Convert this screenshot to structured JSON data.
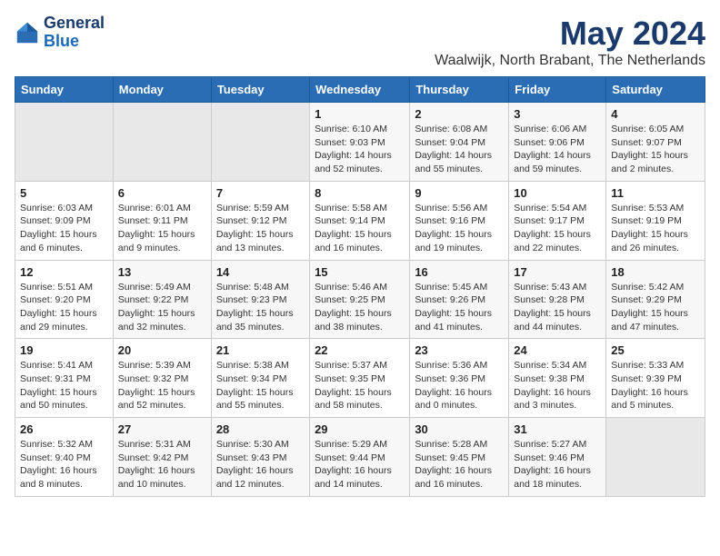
{
  "header": {
    "logo_line1": "General",
    "logo_line2": "Blue",
    "month": "May 2024",
    "location": "Waalwijk, North Brabant, The Netherlands"
  },
  "weekdays": [
    "Sunday",
    "Monday",
    "Tuesday",
    "Wednesday",
    "Thursday",
    "Friday",
    "Saturday"
  ],
  "weeks": [
    [
      {
        "day": "",
        "info": ""
      },
      {
        "day": "",
        "info": ""
      },
      {
        "day": "",
        "info": ""
      },
      {
        "day": "1",
        "info": "Sunrise: 6:10 AM\nSunset: 9:03 PM\nDaylight: 14 hours and 52 minutes."
      },
      {
        "day": "2",
        "info": "Sunrise: 6:08 AM\nSunset: 9:04 PM\nDaylight: 14 hours and 55 minutes."
      },
      {
        "day": "3",
        "info": "Sunrise: 6:06 AM\nSunset: 9:06 PM\nDaylight: 14 hours and 59 minutes."
      },
      {
        "day": "4",
        "info": "Sunrise: 6:05 AM\nSunset: 9:07 PM\nDaylight: 15 hours and 2 minutes."
      }
    ],
    [
      {
        "day": "5",
        "info": "Sunrise: 6:03 AM\nSunset: 9:09 PM\nDaylight: 15 hours and 6 minutes."
      },
      {
        "day": "6",
        "info": "Sunrise: 6:01 AM\nSunset: 9:11 PM\nDaylight: 15 hours and 9 minutes."
      },
      {
        "day": "7",
        "info": "Sunrise: 5:59 AM\nSunset: 9:12 PM\nDaylight: 15 hours and 13 minutes."
      },
      {
        "day": "8",
        "info": "Sunrise: 5:58 AM\nSunset: 9:14 PM\nDaylight: 15 hours and 16 minutes."
      },
      {
        "day": "9",
        "info": "Sunrise: 5:56 AM\nSunset: 9:16 PM\nDaylight: 15 hours and 19 minutes."
      },
      {
        "day": "10",
        "info": "Sunrise: 5:54 AM\nSunset: 9:17 PM\nDaylight: 15 hours and 22 minutes."
      },
      {
        "day": "11",
        "info": "Sunrise: 5:53 AM\nSunset: 9:19 PM\nDaylight: 15 hours and 26 minutes."
      }
    ],
    [
      {
        "day": "12",
        "info": "Sunrise: 5:51 AM\nSunset: 9:20 PM\nDaylight: 15 hours and 29 minutes."
      },
      {
        "day": "13",
        "info": "Sunrise: 5:49 AM\nSunset: 9:22 PM\nDaylight: 15 hours and 32 minutes."
      },
      {
        "day": "14",
        "info": "Sunrise: 5:48 AM\nSunset: 9:23 PM\nDaylight: 15 hours and 35 minutes."
      },
      {
        "day": "15",
        "info": "Sunrise: 5:46 AM\nSunset: 9:25 PM\nDaylight: 15 hours and 38 minutes."
      },
      {
        "day": "16",
        "info": "Sunrise: 5:45 AM\nSunset: 9:26 PM\nDaylight: 15 hours and 41 minutes."
      },
      {
        "day": "17",
        "info": "Sunrise: 5:43 AM\nSunset: 9:28 PM\nDaylight: 15 hours and 44 minutes."
      },
      {
        "day": "18",
        "info": "Sunrise: 5:42 AM\nSunset: 9:29 PM\nDaylight: 15 hours and 47 minutes."
      }
    ],
    [
      {
        "day": "19",
        "info": "Sunrise: 5:41 AM\nSunset: 9:31 PM\nDaylight: 15 hours and 50 minutes."
      },
      {
        "day": "20",
        "info": "Sunrise: 5:39 AM\nSunset: 9:32 PM\nDaylight: 15 hours and 52 minutes."
      },
      {
        "day": "21",
        "info": "Sunrise: 5:38 AM\nSunset: 9:34 PM\nDaylight: 15 hours and 55 minutes."
      },
      {
        "day": "22",
        "info": "Sunrise: 5:37 AM\nSunset: 9:35 PM\nDaylight: 15 hours and 58 minutes."
      },
      {
        "day": "23",
        "info": "Sunrise: 5:36 AM\nSunset: 9:36 PM\nDaylight: 16 hours and 0 minutes."
      },
      {
        "day": "24",
        "info": "Sunrise: 5:34 AM\nSunset: 9:38 PM\nDaylight: 16 hours and 3 minutes."
      },
      {
        "day": "25",
        "info": "Sunrise: 5:33 AM\nSunset: 9:39 PM\nDaylight: 16 hours and 5 minutes."
      }
    ],
    [
      {
        "day": "26",
        "info": "Sunrise: 5:32 AM\nSunset: 9:40 PM\nDaylight: 16 hours and 8 minutes."
      },
      {
        "day": "27",
        "info": "Sunrise: 5:31 AM\nSunset: 9:42 PM\nDaylight: 16 hours and 10 minutes."
      },
      {
        "day": "28",
        "info": "Sunrise: 5:30 AM\nSunset: 9:43 PM\nDaylight: 16 hours and 12 minutes."
      },
      {
        "day": "29",
        "info": "Sunrise: 5:29 AM\nSunset: 9:44 PM\nDaylight: 16 hours and 14 minutes."
      },
      {
        "day": "30",
        "info": "Sunrise: 5:28 AM\nSunset: 9:45 PM\nDaylight: 16 hours and 16 minutes."
      },
      {
        "day": "31",
        "info": "Sunrise: 5:27 AM\nSunset: 9:46 PM\nDaylight: 16 hours and 18 minutes."
      },
      {
        "day": "",
        "info": ""
      }
    ]
  ]
}
